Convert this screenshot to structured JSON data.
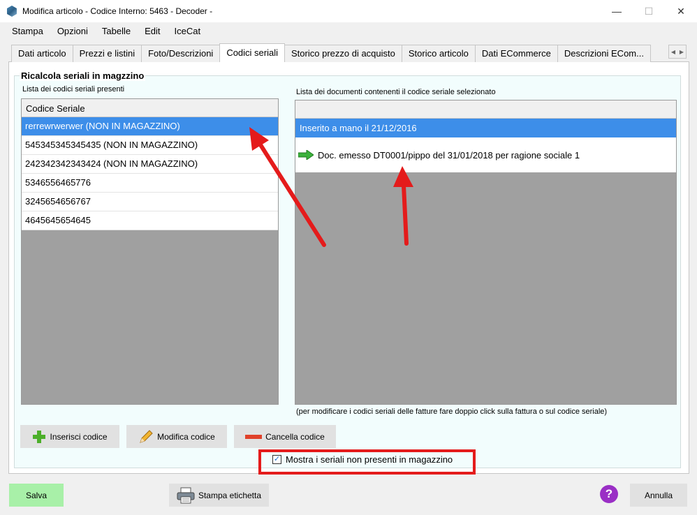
{
  "window": {
    "title": "Modifica articolo - Codice Interno: 5463 - Decoder -",
    "min_glyph": "—",
    "max_glyph": "☐",
    "close_glyph": "✕"
  },
  "menu": [
    "Stampa",
    "Opzioni",
    "Tabelle",
    "Edit",
    "IceCat"
  ],
  "tabs": [
    {
      "label": "Dati articolo",
      "active": false
    },
    {
      "label": "Prezzi e listini",
      "active": false
    },
    {
      "label": "Foto/Descrizioni",
      "active": false
    },
    {
      "label": "Codici seriali",
      "active": true
    },
    {
      "label": "Storico prezzo di acquisto",
      "active": false
    },
    {
      "label": "Storico articolo",
      "active": false
    },
    {
      "label": "Dati ECommerce",
      "active": false
    },
    {
      "label": "Descrizioni  ECom...",
      "active": false
    }
  ],
  "tab_scroll": {
    "left": "◀",
    "right": "▶"
  },
  "group_title": "Ricalcola seriali in magzzino",
  "serials_panel": {
    "label": "Lista dei codici seriali presenti",
    "header": "Codice Seriale",
    "rows": [
      {
        "text": "rerrewrwerwer (NON IN MAGAZZINO)",
        "selected": true
      },
      {
        "text": "545345345345435 (NON IN MAGAZZINO)",
        "selected": false
      },
      {
        "text": "242342342343424 (NON IN MAGAZZINO)",
        "selected": false
      },
      {
        "text": "5346556465776",
        "selected": false
      },
      {
        "text": "3245654656767",
        "selected": false
      },
      {
        "text": "4645645654645",
        "selected": false
      }
    ]
  },
  "documents_panel": {
    "label": "Lista dei documenti contenenti il codice seriale selezionato",
    "rows": [
      {
        "text": "Inserito a mano il 21/12/2016",
        "selected": true,
        "icon": ""
      },
      {
        "text": "Doc. emesso DT0001/pippo del 31/01/2018 per ragione sociale 1",
        "selected": false,
        "icon": "green-arrow-icon"
      }
    ],
    "hint": "(per modificare i codici seriali delle fatture fare doppio click sulla fattura o sul codice seriale)"
  },
  "actions": {
    "insert": "Inserisci codice",
    "edit": "Modifica codice",
    "delete": "Cancella codice"
  },
  "show_missing": {
    "label": "Mostra i seriali non presenti in magazzino",
    "checked": true,
    "check_glyph": "✓"
  },
  "footer": {
    "save": "Salva",
    "print_label": "Stampa etichetta",
    "help_glyph": "?",
    "cancel": "Annulla"
  },
  "colors": {
    "selection": "#3d8ee9",
    "save_button": "#a8f0a8",
    "annotation_red": "#e41b1b",
    "help": "#9a2fc5"
  }
}
